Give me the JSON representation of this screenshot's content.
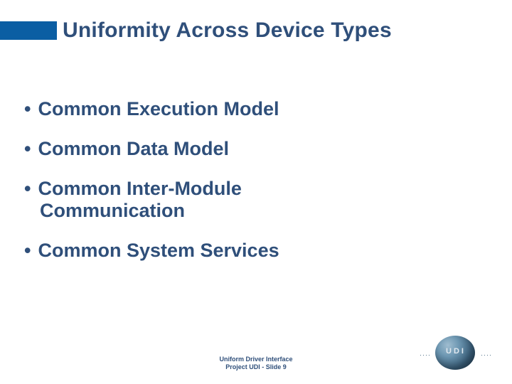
{
  "title": "Uniformity Across Device Types",
  "bullets": {
    "b1": "Common Execution Model",
    "b2": "Common Data Model",
    "b3_l1": "Common Inter-Module",
    "b3_l2": "Communication",
    "b4": "Common System Services"
  },
  "footer": {
    "line1": "Uniform Driver Interface",
    "line2": "Project UDI  - Slide 9"
  },
  "logo": {
    "text": "UDI"
  }
}
